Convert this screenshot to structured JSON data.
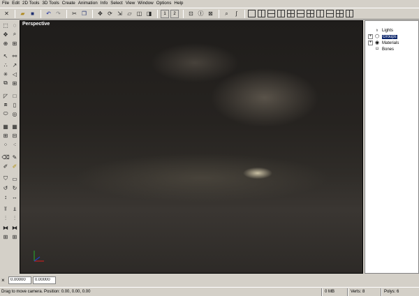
{
  "menu": [
    "File",
    "Edit",
    "2D Tools",
    "3D Tools",
    "Create",
    "Animation",
    "Info",
    "Select",
    "View",
    "Window",
    "Options",
    "Help"
  ],
  "toolbar": {
    "frame_1": "1",
    "frame_2": "2"
  },
  "viewport": {
    "title": "Perspective"
  },
  "scene_tree": [
    {
      "label": "Lights",
      "icon": "bulb-icon",
      "expandable": false
    },
    {
      "label": "Groups",
      "icon": "group-icon",
      "expandable": true,
      "selected": true
    },
    {
      "label": "Materials",
      "icon": "material-icon",
      "expandable": true
    },
    {
      "label": "Bones",
      "icon": "bone-icon",
      "expandable": false
    }
  ],
  "coords": {
    "x": "0.00000",
    "y": "0.00000"
  },
  "status": {
    "message": "Drag to move camera. Position: 0.00, 0.00, 0.00",
    "memory": "0 MB",
    "verts": "Verts: 8",
    "polys": "Polys: 6"
  },
  "colors": {
    "selection": "#0a246a",
    "chrome": "#d4d0c8",
    "viewport_dark": "#262320"
  }
}
